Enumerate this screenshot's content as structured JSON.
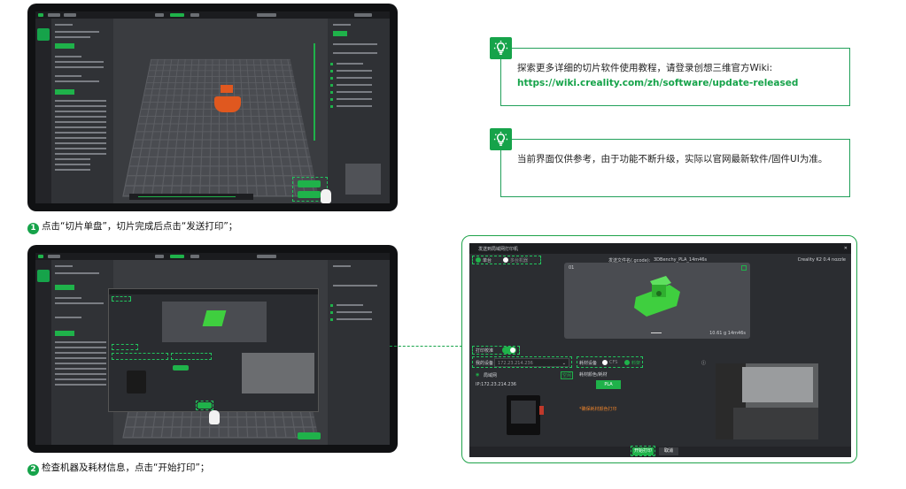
{
  "steps": [
    {
      "number": "1",
      "text": "点击“切片单盘”，切片完成后点击“发送打印”；"
    },
    {
      "number": "2",
      "text": "检查机器及耗材信息，点击“开始打印”；"
    }
  ],
  "tips": [
    {
      "line1": "探索更多详细的切片软件使用教程，请登录创想三维官方Wiki:",
      "link": "https://wiki.creality.com/zh/software/update-released",
      "icon": "lightbulb-icon"
    },
    {
      "text": "当前界面仅供参考，由于功能不断升级，实际以官网最新软件/固件UI为准。",
      "icon": "lightbulb-icon"
    }
  ],
  "dialog": {
    "title": "发送到局域网打印机",
    "mode_lan": "单台",
    "mode_multi": "多台机器",
    "send_file_label": "发送文件名(.gcode):",
    "file_name": "3DBenchy_PLA_14m46s",
    "printer_model": "Creality K2 0.4 nozzle",
    "plate_number": "01",
    "preview_stats": "10.61 g  14m46s",
    "leveling_label": "打印校准",
    "device_label": "我的设备",
    "device_value": "172.23.214.236",
    "lan_label": "局域网",
    "online_badge": "空闲",
    "ip_text": "IP:172.23.214.236",
    "filament_label": "耗材设备",
    "cfs_label": "CFS",
    "spool_label": "料架",
    "mapping_label": "耗材颜色/耗材",
    "filament_type": "PLA",
    "warning": "*确保耗材颜色打印",
    "start_button": "开始打印",
    "cancel_button": "取消",
    "colors": {
      "accent": "#1fb24a",
      "model": "#3fcf3f",
      "warning": "#e8812b"
    }
  },
  "slicer": {
    "top_tabs": [
      "准备",
      "预览",
      "设备"
    ],
    "active_tab": "预览",
    "brand": "creality",
    "left_panel_title": "打印机",
    "printer_name": "Creality K2 0.4 nozzle",
    "gcode_label": "G-code 预览",
    "slice_button": "切片单盘",
    "send_button": "发送打印"
  }
}
